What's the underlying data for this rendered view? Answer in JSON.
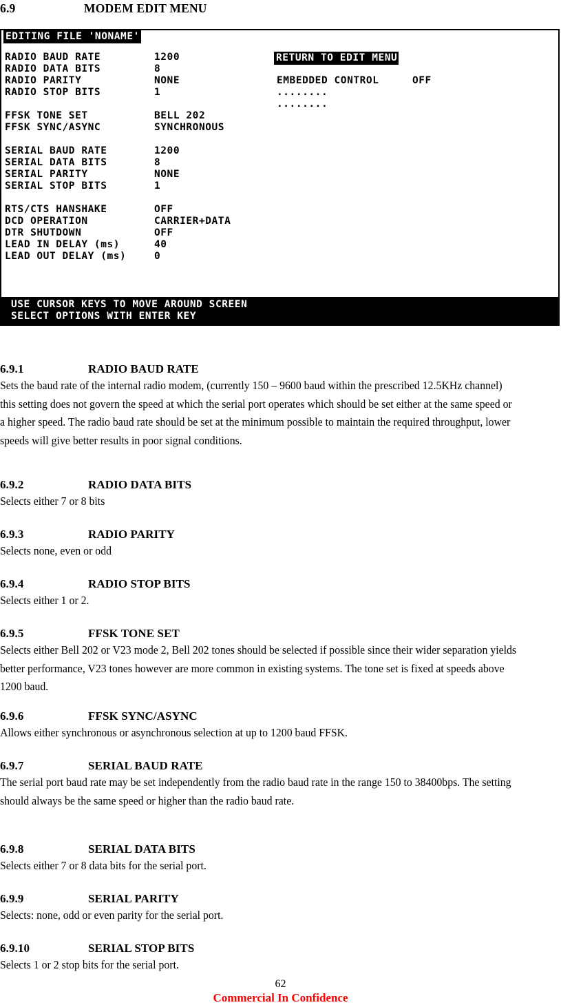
{
  "page": {
    "heading": {
      "number": "6.9",
      "title": "MODEM EDIT MENU"
    },
    "page_number": "62",
    "confidentiality_notice": "Commercial In Confidence"
  },
  "terminal": {
    "title_bar": "EDITING FILE 'NONAME'",
    "menu_button": "RETURN TO EDIT MENU",
    "left_column": [
      {
        "label": "RADIO BAUD RATE",
        "value": "1200"
      },
      {
        "label": "RADIO DATA BITS",
        "value": "8"
      },
      {
        "label": "RADIO PARITY",
        "value": "NONE"
      },
      {
        "label": "RADIO STOP BITS",
        "value": "1"
      },
      {
        "label": "FFSK TONE SET",
        "value": "BELL 202"
      },
      {
        "label": "FFSK SYNC/ASYNC",
        "value": "SYNCHRONOUS"
      },
      {
        "label": "SERIAL BAUD RATE",
        "value": "1200"
      },
      {
        "label": "SERIAL DATA BITS",
        "value": "8"
      },
      {
        "label": "SERIAL PARITY",
        "value": "NONE"
      },
      {
        "label": "SERIAL STOP BITS",
        "value": "1"
      },
      {
        "label": "RTS/CTS HANSHAKE",
        "value": "OFF"
      },
      {
        "label": "DCD OPERATION",
        "value": "CARRIER+DATA"
      },
      {
        "label": "DTR SHUTDOWN",
        "value": "OFF"
      },
      {
        "label": "LEAD IN DELAY (ms)",
        "value": "40"
      },
      {
        "label": "LEAD OUT DELAY (ms)",
        "value": "0"
      }
    ],
    "right_column": [
      {
        "label": "EMBEDDED CONTROL",
        "value": "OFF"
      },
      {
        "label": "........",
        "value": ""
      },
      {
        "label": "........",
        "value": ""
      }
    ],
    "footer_lines": [
      "USE CURSOR KEYS TO MOVE AROUND SCREEN",
      "SELECT OPTIONS WITH ENTER KEY"
    ],
    "colors": {
      "background": "#ffffff",
      "foreground": "#000000",
      "highlight_bg": "#000000",
      "highlight_fg": "#ffffff"
    }
  },
  "sections": [
    {
      "number": "6.9.1",
      "title": "RADIO BAUD RATE",
      "body": "Sets the baud rate of the internal radio modem, (currently 150 – 9600 baud within the prescribed 12.5KHz channel) this setting does not govern the speed at which the serial port operates which should be set either at the same speed or a higher speed. The radio baud rate should be set at the minimum possible to maintain the required throughput, lower speeds will give better results in poor signal conditions."
    },
    {
      "number": "6.9.2",
      "title": "RADIO DATA BITS",
      "body": "Selects either 7 or 8 bits"
    },
    {
      "number": "6.9.3",
      "title": "RADIO PARITY",
      "body": "Selects none, even or odd"
    },
    {
      "number": "6.9.4",
      "title": "RADIO STOP BITS",
      "body": "Selects either 1 or 2."
    },
    {
      "number": "6.9.5",
      "title": "FFSK TONE SET",
      "body": "Selects either Bell 202 or V23 mode 2, Bell 202 tones should be selected if possible since their wider separation yields better performance, V23 tones however are more common in existing systems. The tone set is fixed at speeds above 1200 baud."
    },
    {
      "number": "6.9.6",
      "title": "FFSK SYNC/ASYNC",
      "body": "Allows either synchronous or asynchronous selection at up to 1200 baud FFSK."
    },
    {
      "number": "6.9.7",
      "title": "SERIAL BAUD RATE",
      "body": "The serial port baud rate may be set independently from the radio baud rate in the range 150 to 38400bps. The setting should always be the same speed or higher than the radio baud rate."
    },
    {
      "number": "6.9.8",
      "title": "SERIAL DATA BITS",
      "body": "Selects either 7 or 8 data bits for the serial port."
    },
    {
      "number": "6.9.9",
      "title": "SERIAL PARITY",
      "body": "Selects:  none, odd or even parity for the serial port."
    },
    {
      "number": "6.9.10",
      "title": "SERIAL STOP BITS",
      "body": "Selects 1 or 2 stop bits for the serial port."
    }
  ]
}
